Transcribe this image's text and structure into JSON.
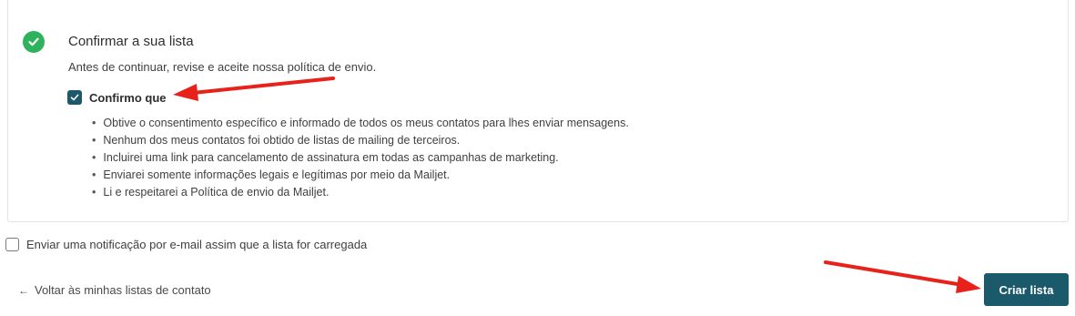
{
  "confirm_section": {
    "title": "Confirmar a sua lista",
    "description": "Antes de continuar, revise e aceite nossa política de envio.",
    "checkbox_label": "Confirmo que",
    "checkbox_checked": true,
    "bullets": [
      "Obtive o consentimento específico e informado de todos os meus contatos para lhes enviar mensagens.",
      "Nenhum dos meus contatos foi obtido de listas de mailing de terceiros.",
      "Incluirei uma link para cancelamento de assinatura em todas as campanhas de marketing.",
      "Enviarei somente informações legais e legítimas por meio da Mailjet.",
      "Li e respeitarei a Política de envio da Mailjet."
    ]
  },
  "notification": {
    "label": "Enviar uma notificação por e-mail assim que a lista for carregada",
    "checked": false
  },
  "footer": {
    "back_arrow": "←",
    "back_label": "Voltar às minhas listas de contato",
    "create_label": "Criar lista"
  },
  "colors": {
    "success": "#2eb25c",
    "primary": "#1b5a6b",
    "annotation_arrow": "#e8221b"
  },
  "icons": {
    "status": "check-circle-icon",
    "checkbox": "checkmark-icon"
  }
}
